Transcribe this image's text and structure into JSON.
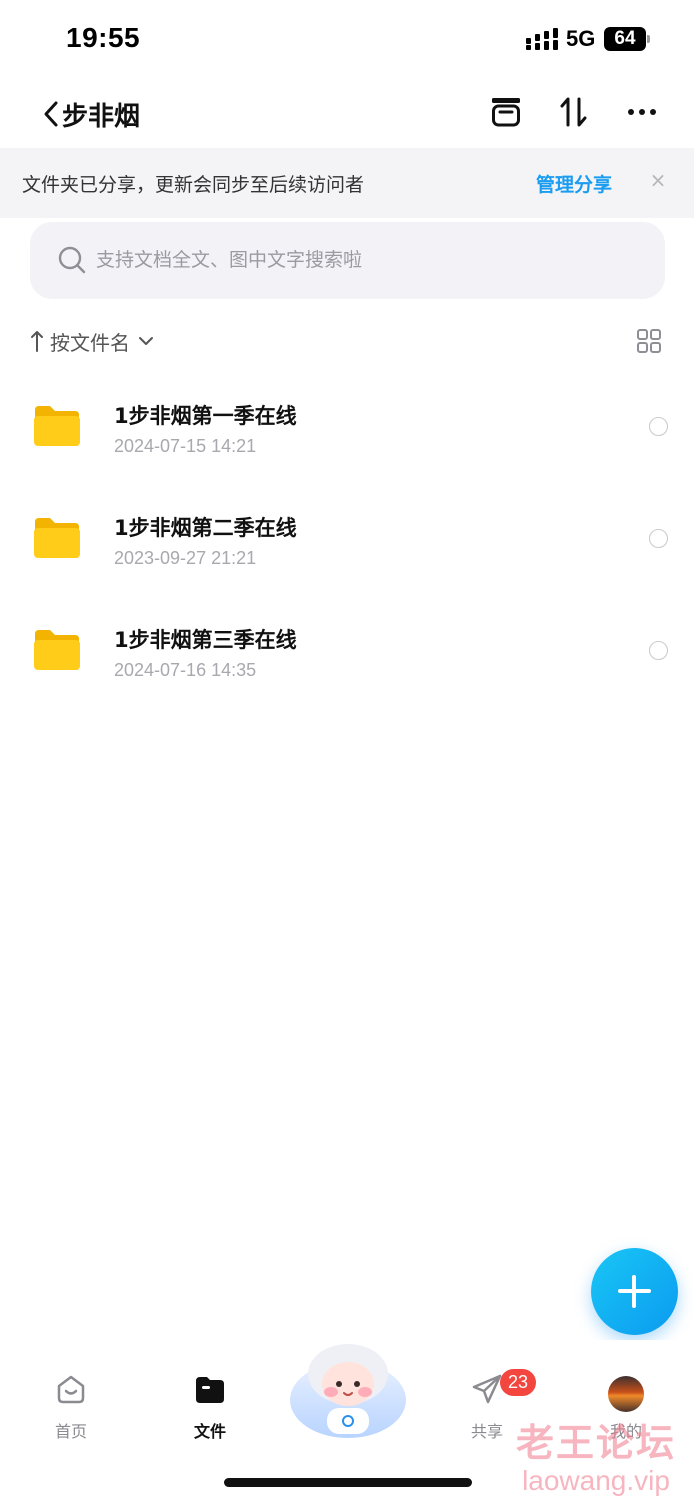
{
  "status_bar": {
    "time": "19:55",
    "network": "5G",
    "battery": "64"
  },
  "header": {
    "title": "步非烟"
  },
  "share_banner": {
    "message": "文件夹已分享，更新会同步至后续访问者",
    "manage_label": "管理分享",
    "close_glyph": "×"
  },
  "search": {
    "placeholder": "支持文档全文、图中文字搜索啦"
  },
  "sort": {
    "label": "按文件名"
  },
  "files": [
    {
      "name": "1步非烟第一季在线",
      "date": "2024-07-15 14:21"
    },
    {
      "name": "1步非烟第二季在线",
      "date": "2023-09-27 21:21"
    },
    {
      "name": "1步非烟第三季在线",
      "date": "2024-07-16 14:35"
    }
  ],
  "tabs": [
    {
      "label": "首页",
      "icon": "home-icon"
    },
    {
      "label": "文件",
      "icon": "folder-icon",
      "active": true
    },
    {
      "label": "共享",
      "icon": "paper-plane-icon",
      "badge": "23"
    },
    {
      "label": "我的",
      "icon": "avatar"
    }
  ],
  "watermark": {
    "cn": "老王论坛",
    "url": "laowang.vip"
  },
  "colors": {
    "accent": "#1a9cf0",
    "badge": "#f2463f",
    "folder": "#ffcc1a"
  }
}
